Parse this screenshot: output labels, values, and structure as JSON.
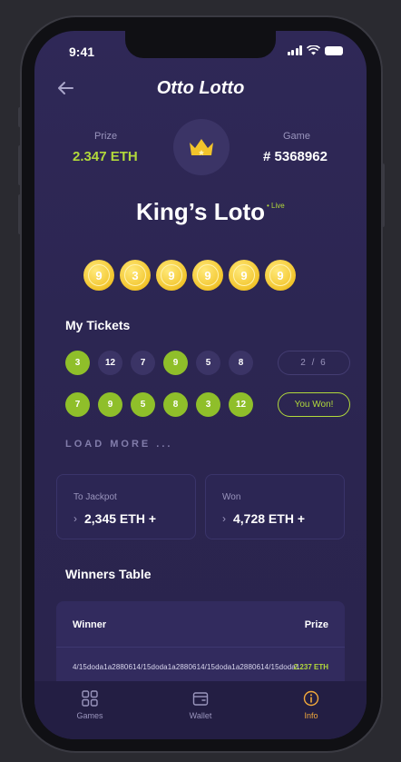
{
  "status": {
    "time": "9:41"
  },
  "app": {
    "title": "Otto Lotto"
  },
  "stats": {
    "prize_label": "Prize",
    "prize_value": "2.347 ETH",
    "game_label": "Game",
    "game_value": "# 5368962"
  },
  "game": {
    "name": "King’s Loto",
    "live_label": "• Live"
  },
  "drawn_balls": [
    "9",
    "3",
    "9",
    "9",
    "9",
    "9"
  ],
  "tickets": {
    "title": "My Tickets",
    "rows": [
      {
        "numbers": [
          {
            "value": "3",
            "matched": true
          },
          {
            "value": "12",
            "matched": false
          },
          {
            "value": "7",
            "matched": false
          },
          {
            "value": "9",
            "matched": true
          },
          {
            "value": "5",
            "matched": false
          },
          {
            "value": "8",
            "matched": false
          }
        ],
        "status": "2 / 6"
      },
      {
        "numbers": [
          {
            "value": "7",
            "matched": true
          },
          {
            "value": "9",
            "matched": true
          },
          {
            "value": "5",
            "matched": true
          },
          {
            "value": "8",
            "matched": true
          },
          {
            "value": "3",
            "matched": true
          },
          {
            "value": "12",
            "matched": true
          }
        ],
        "status": "You Won!"
      }
    ],
    "load_more": "LOAD MORE ..."
  },
  "cards": {
    "jackpot_label": "To Jackpot",
    "jackpot_value": "2,345 ETH +",
    "won_label": "Won",
    "won_value": "4,728 ETH +"
  },
  "winners": {
    "title": "Winners Table",
    "col_winner": "Winner",
    "col_prize": "Prize",
    "rows": [
      {
        "address": "4/15doda1a2880614/15doda1a2880614/15doda1a2880614/15doda1",
        "prize": "2.237 ETH"
      }
    ]
  },
  "tabbar": {
    "games": "Games",
    "wallet": "Wallet",
    "info": "Info"
  },
  "colors": {
    "accent_green": "#b2d93b",
    "ball_gold": "#f2c42b",
    "active_tab": "#f2a93b",
    "background": "#2f2857"
  }
}
